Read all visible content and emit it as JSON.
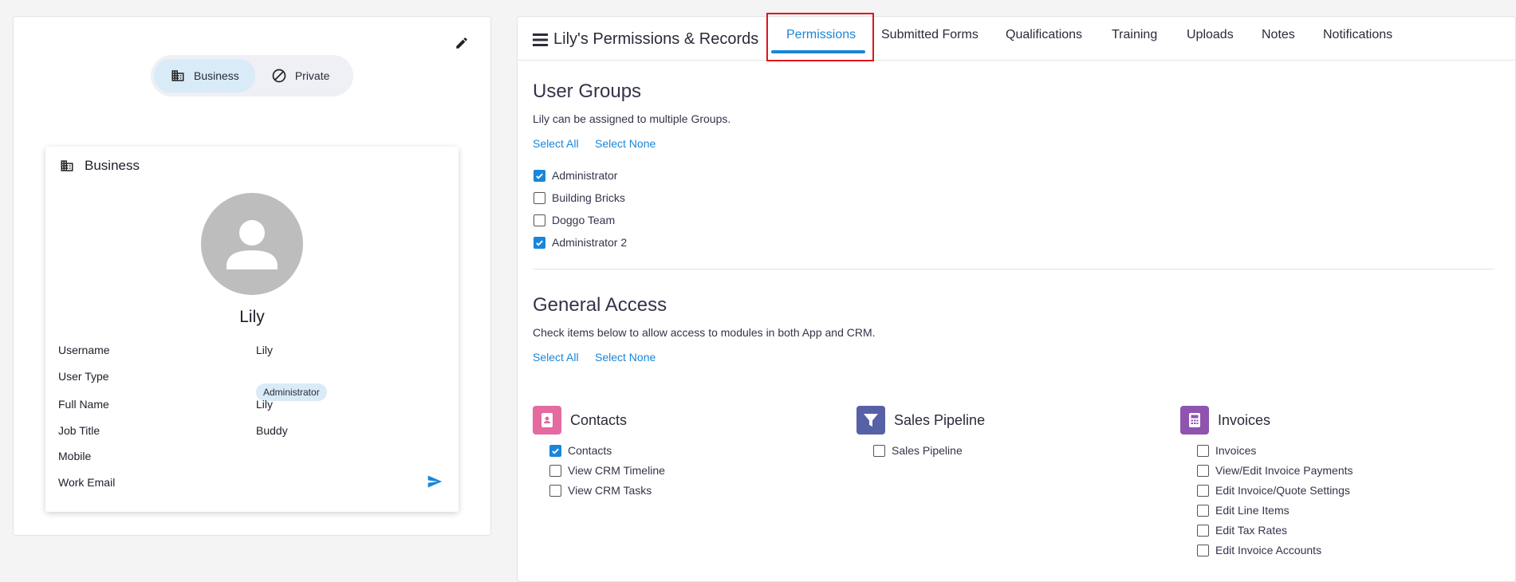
{
  "profile": {
    "mode_toggle": {
      "business_label": "Business",
      "private_label": "Private",
      "active": "business"
    },
    "card": {
      "header_label": "Business",
      "name": "Lily",
      "fields": [
        {
          "label": "Username",
          "value": "Lily"
        },
        {
          "label": "User Type",
          "value": "Administrator"
        },
        {
          "label": "Full Name",
          "value": "Lily"
        },
        {
          "label": "Job Title",
          "value": "Buddy"
        },
        {
          "label": "Mobile",
          "value": ""
        },
        {
          "label": "Work Email",
          "value": ""
        }
      ]
    }
  },
  "records": {
    "title": "Lily's Permissions & Records",
    "tabs": [
      {
        "label": "Permissions",
        "active": true
      },
      {
        "label": "Submitted Forms"
      },
      {
        "label": "Qualifications"
      },
      {
        "label": "Training"
      },
      {
        "label": "Uploads"
      },
      {
        "label": "Notes"
      },
      {
        "label": "Notifications"
      }
    ]
  },
  "user_groups": {
    "title": "User Groups",
    "description": "Lily can be assigned to multiple Groups.",
    "select_all": "Select All",
    "select_none": "Select None",
    "items": [
      {
        "label": "Administrator",
        "checked": true
      },
      {
        "label": "Building Bricks",
        "checked": false
      },
      {
        "label": "Doggo Team",
        "checked": false
      },
      {
        "label": "Administrator 2",
        "checked": true
      }
    ]
  },
  "general_access": {
    "title": "General Access",
    "description": "Check items below to allow access to modules in both App and CRM.",
    "select_all": "Select All",
    "select_none": "Select None",
    "modules": [
      {
        "name": "Contacts",
        "icon": "contacts-book-icon",
        "color": "#e46aa0",
        "items": [
          {
            "label": "Contacts",
            "checked": true
          },
          {
            "label": "View CRM Timeline",
            "checked": false
          },
          {
            "label": "View CRM Tasks",
            "checked": false
          }
        ]
      },
      {
        "name": "Sales Pipeline",
        "icon": "funnel-icon",
        "color": "#5661a6",
        "items": [
          {
            "label": "Sales Pipeline",
            "checked": false
          }
        ]
      },
      {
        "name": "Invoices",
        "icon": "calculator-icon",
        "color": "#8e54b0",
        "items": [
          {
            "label": "Invoices",
            "checked": false
          },
          {
            "label": "View/Edit Invoice Payments",
            "checked": false
          },
          {
            "label": "Edit Invoice/Quote Settings",
            "checked": false
          },
          {
            "label": "Edit Line Items",
            "checked": false
          },
          {
            "label": "Edit Tax Rates",
            "checked": false
          },
          {
            "label": "Edit Invoice Accounts",
            "checked": false
          }
        ]
      }
    ]
  },
  "colors": {
    "accent": "#1a86d9",
    "highlight": "#e0141e",
    "badge_bg": "#d8ebf7"
  }
}
